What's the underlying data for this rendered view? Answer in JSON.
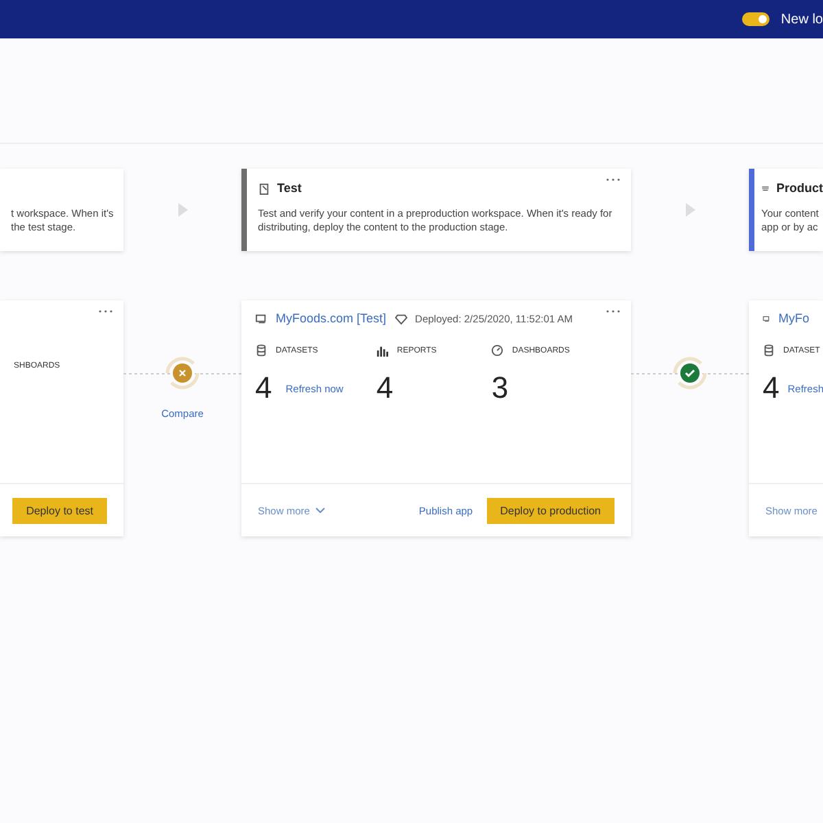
{
  "header": {
    "toggle": {
      "on": true
    },
    "label": "New lo"
  },
  "stages": [
    {
      "description": [
        "t workspace. When it's",
        "the test stage."
      ]
    },
    {
      "title": "Test",
      "description": [
        "Test and verify your content in a preproduction workspace. When it's ready for",
        "distributing, deploy the content to the production stage."
      ],
      "color": "#6e6e6e",
      "menu": true
    },
    {
      "title": "Product",
      "description": [
        "Your content",
        "app or by ac"
      ],
      "color": "#4f6bd8"
    }
  ],
  "workspaces": [
    {
      "kind": "left",
      "stat_label": "SHBOARDS",
      "deploy": "Deploy to test"
    },
    {
      "kind": "full",
      "name": "MyFoods.com [Test]",
      "deployed": "Deployed: 2/25/2020, 11:52:01 AM",
      "stats": [
        {
          "label": "DATASETS",
          "value": "4",
          "link": "Refresh now"
        },
        {
          "label": "REPORTS",
          "value": "4"
        },
        {
          "label": "DASHBOARDS",
          "value": "3"
        }
      ],
      "show_more": "Show more",
      "publish": "Publish app",
      "deploy": "Deploy to production"
    },
    {
      "kind": "right",
      "name": "MyFo",
      "stat_label": "DATASET",
      "value": "4",
      "link": "Refresh",
      "show_more": "Show more"
    }
  ],
  "comparisons": [
    {
      "in_sync": false,
      "label": "Compare"
    },
    {
      "in_sync": true
    }
  ]
}
